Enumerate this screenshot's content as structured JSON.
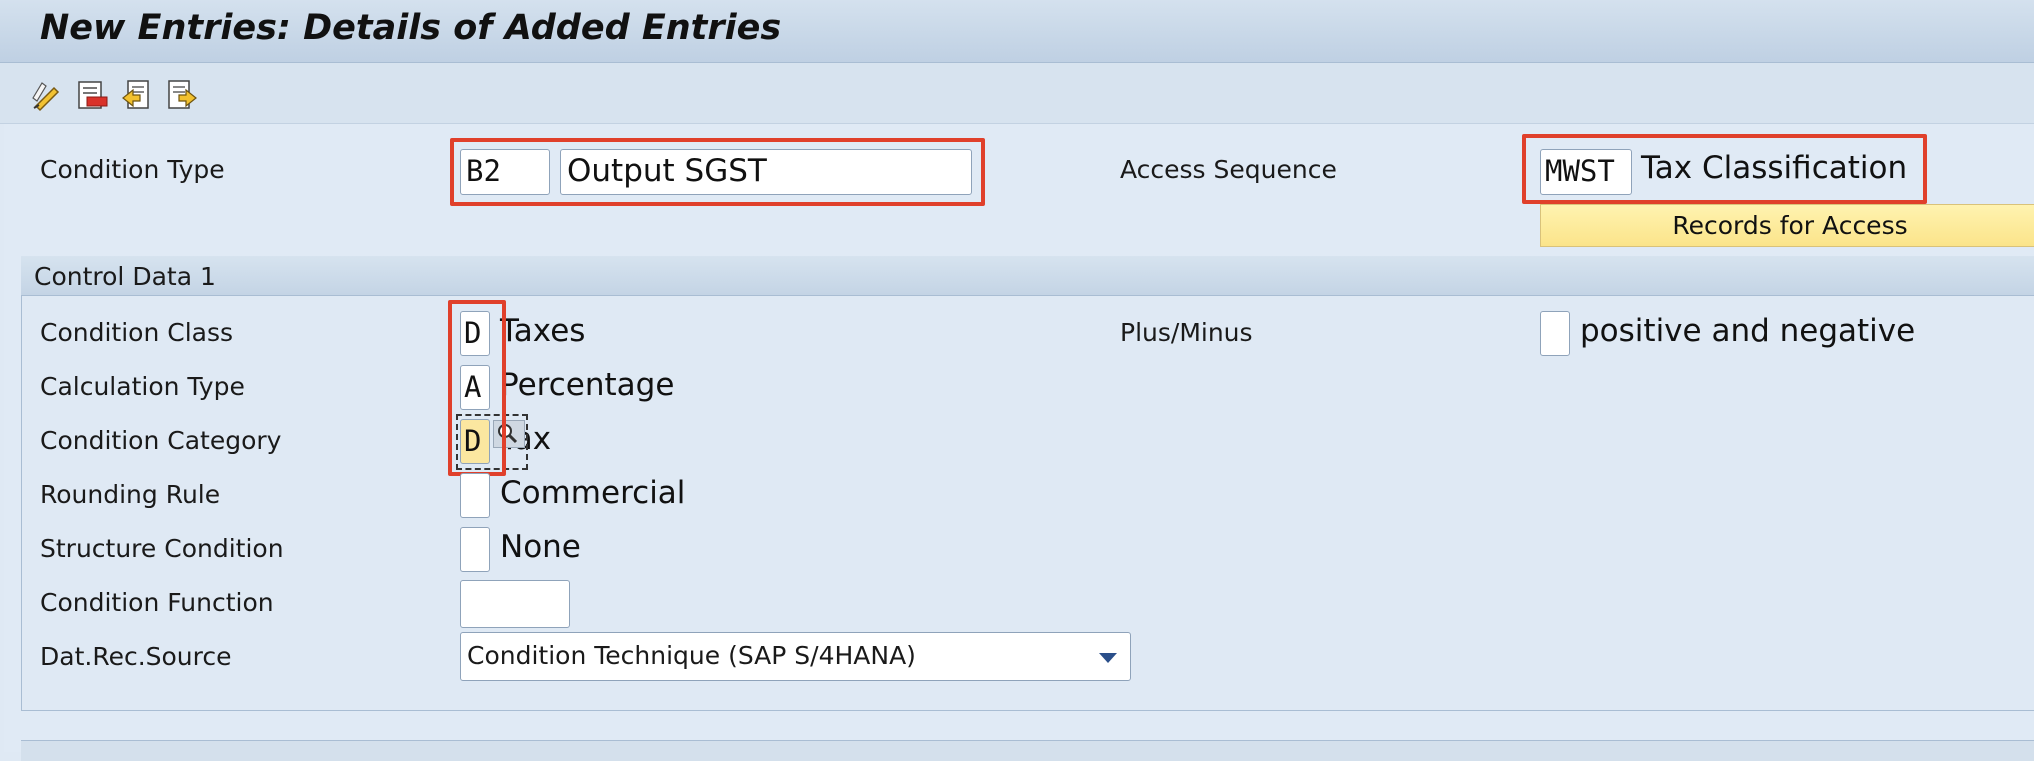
{
  "window": {
    "title": "New Entries: Details of Added Entries"
  },
  "toolbar": {
    "buttons": [
      {
        "icon": "display-change-icon"
      },
      {
        "icon": "delete-icon"
      },
      {
        "icon": "previous-entry-icon"
      },
      {
        "icon": "next-entry-icon"
      }
    ]
  },
  "header": {
    "condition_type": {
      "label": "Condition Type",
      "code": "B2",
      "description": "Output SGST"
    },
    "access_sequence": {
      "label": "Access Sequence",
      "code": "MWST",
      "description": "Tax Classification"
    },
    "records_button": "Records for Access"
  },
  "control_data": {
    "title": "Control Data 1",
    "condition_class": {
      "label": "Condition Class",
      "code": "D",
      "description": "Taxes"
    },
    "plus_minus": {
      "label": "Plus/Minus",
      "code": "",
      "description": "positive and negative"
    },
    "calculation_type": {
      "label": "Calculation Type",
      "code": "A",
      "description": "Percentage"
    },
    "condition_category": {
      "label": "Condition Category",
      "code": "D",
      "description": "Tax"
    },
    "rounding_rule": {
      "label": "Rounding Rule",
      "code": "",
      "description": "Commercial"
    },
    "structure_condition": {
      "label": "Structure Condition",
      "code": "",
      "description": "None"
    },
    "condition_function": {
      "label": "Condition Function",
      "code": ""
    },
    "dat_rec_source": {
      "label": "Dat.Rec.Source",
      "selected": "Condition Technique (SAP S/4HANA)"
    }
  },
  "colors": {
    "highlight": "#e0402b",
    "active_field": "#fbe7a0",
    "button": "#fbe48a"
  }
}
